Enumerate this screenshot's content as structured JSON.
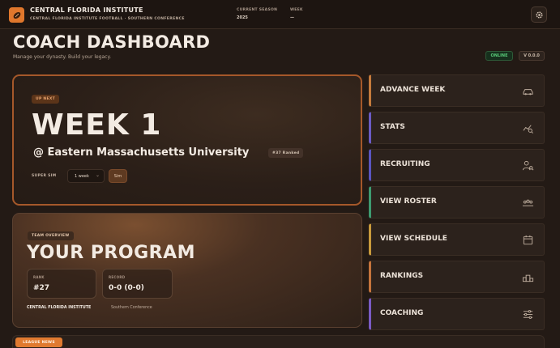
{
  "header": {
    "school_name": "CENTRAL FLORIDA INSTITUTE",
    "school_subtitle": "CENTRAL FLORIDA INSTITUTE FOOTBALL · SOUTHERN CONFERENCE",
    "season_label": "CURRENT SEASON",
    "season_value": "2025",
    "week_label": "WEEK",
    "week_value": "—"
  },
  "page": {
    "title": "COACH DASHBOARD",
    "subtitle": "Manage your dynasty. Build your legacy.",
    "status_online": "ONLINE",
    "version": "V 0.0.0"
  },
  "next_game": {
    "badge": "UP NEXT",
    "week": "WEEK 1",
    "opponent": "@ Eastern Massachusetts University",
    "opponent_rank": "#37 Ranked",
    "sim_label": "SUPER SIM",
    "sim_select_value": "1 week",
    "sim_button": "Sim"
  },
  "program": {
    "badge": "TEAM OVERVIEW",
    "title": "YOUR PROGRAM",
    "rank_label": "RANK",
    "rank_value": "#27",
    "record_label": "RECORD",
    "record_value": "0-0 (0-0)",
    "school": "CENTRAL FLORIDA INSTITUTE",
    "conference": "Southern Conference"
  },
  "nav": [
    {
      "label": "ADVANCE WEEK",
      "icon": "car-icon",
      "accent": "#c47a3c"
    },
    {
      "label": "STATS",
      "icon": "chart-search-icon",
      "accent": "#6a5bc4"
    },
    {
      "label": "RECRUITING",
      "icon": "user-search-icon",
      "accent": "#5a55c0"
    },
    {
      "label": "VIEW ROSTER",
      "icon": "team-icon",
      "accent": "#3e9a70"
    },
    {
      "label": "VIEW SCHEDULE",
      "icon": "calendar-icon",
      "accent": "#c89a3c"
    },
    {
      "label": "RANKINGS",
      "icon": "podium-icon",
      "accent": "#c4743c"
    },
    {
      "label": "COACHING",
      "icon": "sliders-icon",
      "accent": "#7a5bc4"
    }
  ],
  "footer": {
    "news_badge": "LEAGUE NEWS"
  },
  "colors": {
    "accent": "#e0772c",
    "background": "#231a15",
    "online": "#58c878"
  }
}
